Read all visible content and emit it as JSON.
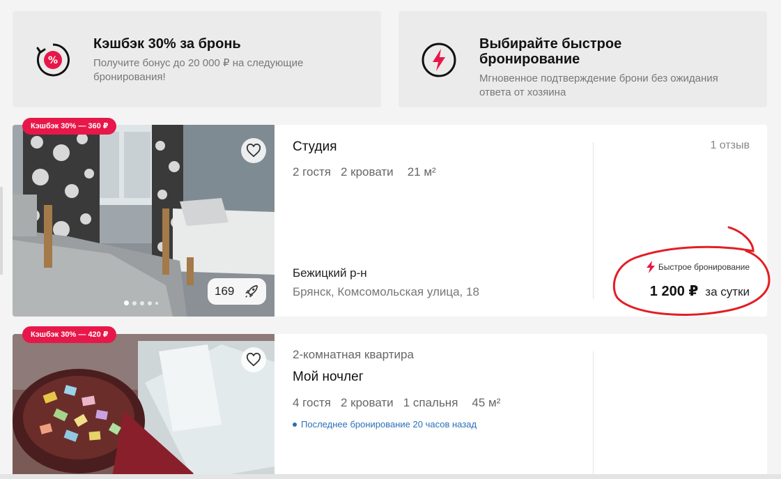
{
  "promos": [
    {
      "title": "Кэшбэк 30% за бронь",
      "subtitle_line1": "Получите бонус до 20 000 ₽ на следующие",
      "subtitle_line2": "бронирования!",
      "icon": "cashback-percent-icon"
    },
    {
      "title": "Выбирайте быстрое бронирование",
      "subtitle_line1": "Мгновенное подтверждение брони без ожидания",
      "subtitle_line2": "ответа от хозяина",
      "icon": "lightning-icon"
    }
  ],
  "listings": [
    {
      "cashback_badge": "Кэшбэк 30% — 360 ₽",
      "kind": "",
      "name": "Студия",
      "specs": [
        "2 гостя",
        "2 кровати",
        "21 м²"
      ],
      "district": "Бежицкий р-н",
      "address": "Брянск, Комсомольская улица, 18",
      "reviews": "1 отзыв",
      "fast_booking": "Быстрое бронирование",
      "price": "1 200 ₽",
      "price_unit": "за сутки",
      "views": "169"
    },
    {
      "cashback_badge": "Кэшбэк 30% — 420 ₽",
      "kind": "2-комнатная квартира",
      "name": "Мой ночлег",
      "specs": [
        "4 гостя",
        "2 кровати",
        "1 спальня",
        "45 м²"
      ],
      "last_booking": "Последнее бронирование 20 часов назад"
    }
  ],
  "colors": {
    "accent": "#e8174a",
    "info_blue": "#2a6fb8",
    "annotation_red": "#e31e24"
  }
}
